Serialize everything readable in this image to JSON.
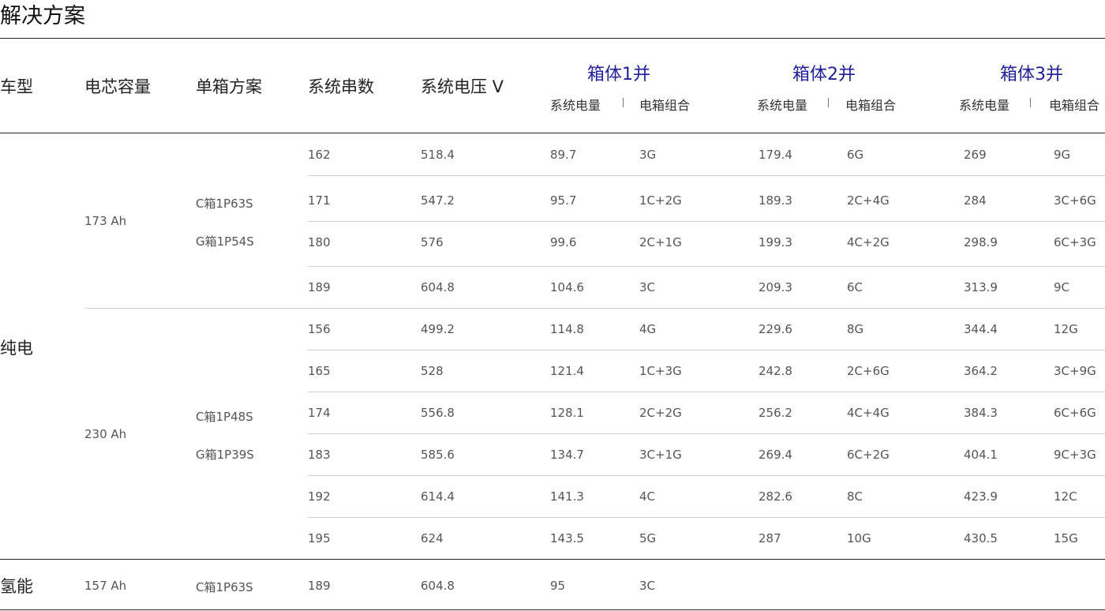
{
  "page_title": "解决方案",
  "headers": {
    "type": "车型",
    "capacity": "电芯容量",
    "box_plan": "单箱方案",
    "series": "系统串数",
    "voltage": "系统电压 V",
    "groups": [
      {
        "title": "箱体1并",
        "energy": "系统电量",
        "combo": "电箱组合"
      },
      {
        "title": "箱体2并",
        "energy": "系统电量",
        "combo": "电箱组合"
      },
      {
        "title": "箱体3并",
        "energy": "系统电量",
        "combo": "电箱组合"
      }
    ]
  },
  "categories": {
    "electric": "纯电",
    "hydrogen": "氢能"
  },
  "blocks": [
    {
      "capacity": "173 Ah",
      "plan_c": "C箱1P63S",
      "plan_g": "G箱1P54S"
    },
    {
      "capacity": "230 Ah",
      "plan_c": "C箱1P48S",
      "plan_g": "G箱1P39S"
    },
    {
      "capacity": "157 Ah",
      "plan_c": "C箱1P63S"
    }
  ],
  "rows": [
    [
      "162",
      "518.4",
      "89.7",
      "3G",
      "179.4",
      "6G",
      "269",
      "9G"
    ],
    [
      "171",
      "547.2",
      "95.7",
      "1C+2G",
      "189.3",
      "2C+4G",
      "284",
      "3C+6G"
    ],
    [
      "180",
      "576",
      "99.6",
      "2C+1G",
      "199.3",
      "4C+2G",
      "298.9",
      "6C+3G"
    ],
    [
      "189",
      "604.8",
      "104.6",
      "3C",
      "209.3",
      "6C",
      "313.9",
      "9C"
    ],
    [
      "156",
      "499.2",
      "114.8",
      "4G",
      "229.6",
      "8G",
      "344.4",
      "12G"
    ],
    [
      "165",
      "528",
      "121.4",
      "1C+3G",
      "242.8",
      "2C+6G",
      "364.2",
      "3C+9G"
    ],
    [
      "174",
      "556.8",
      "128.1",
      "2C+2G",
      "256.2",
      "4C+4G",
      "384.3",
      "6C+6G"
    ],
    [
      "183",
      "585.6",
      "134.7",
      "3C+1G",
      "269.4",
      "6C+2G",
      "404.1",
      "9C+3G"
    ],
    [
      "192",
      "614.4",
      "141.3",
      "4C",
      "282.6",
      "8C",
      "423.9",
      "12C"
    ],
    [
      "195",
      "624",
      "143.5",
      "5G",
      "287",
      "10G",
      "430.5",
      "15G"
    ],
    [
      "189",
      "604.8",
      "95",
      "3C",
      "",
      "",
      "",
      ""
    ]
  ]
}
